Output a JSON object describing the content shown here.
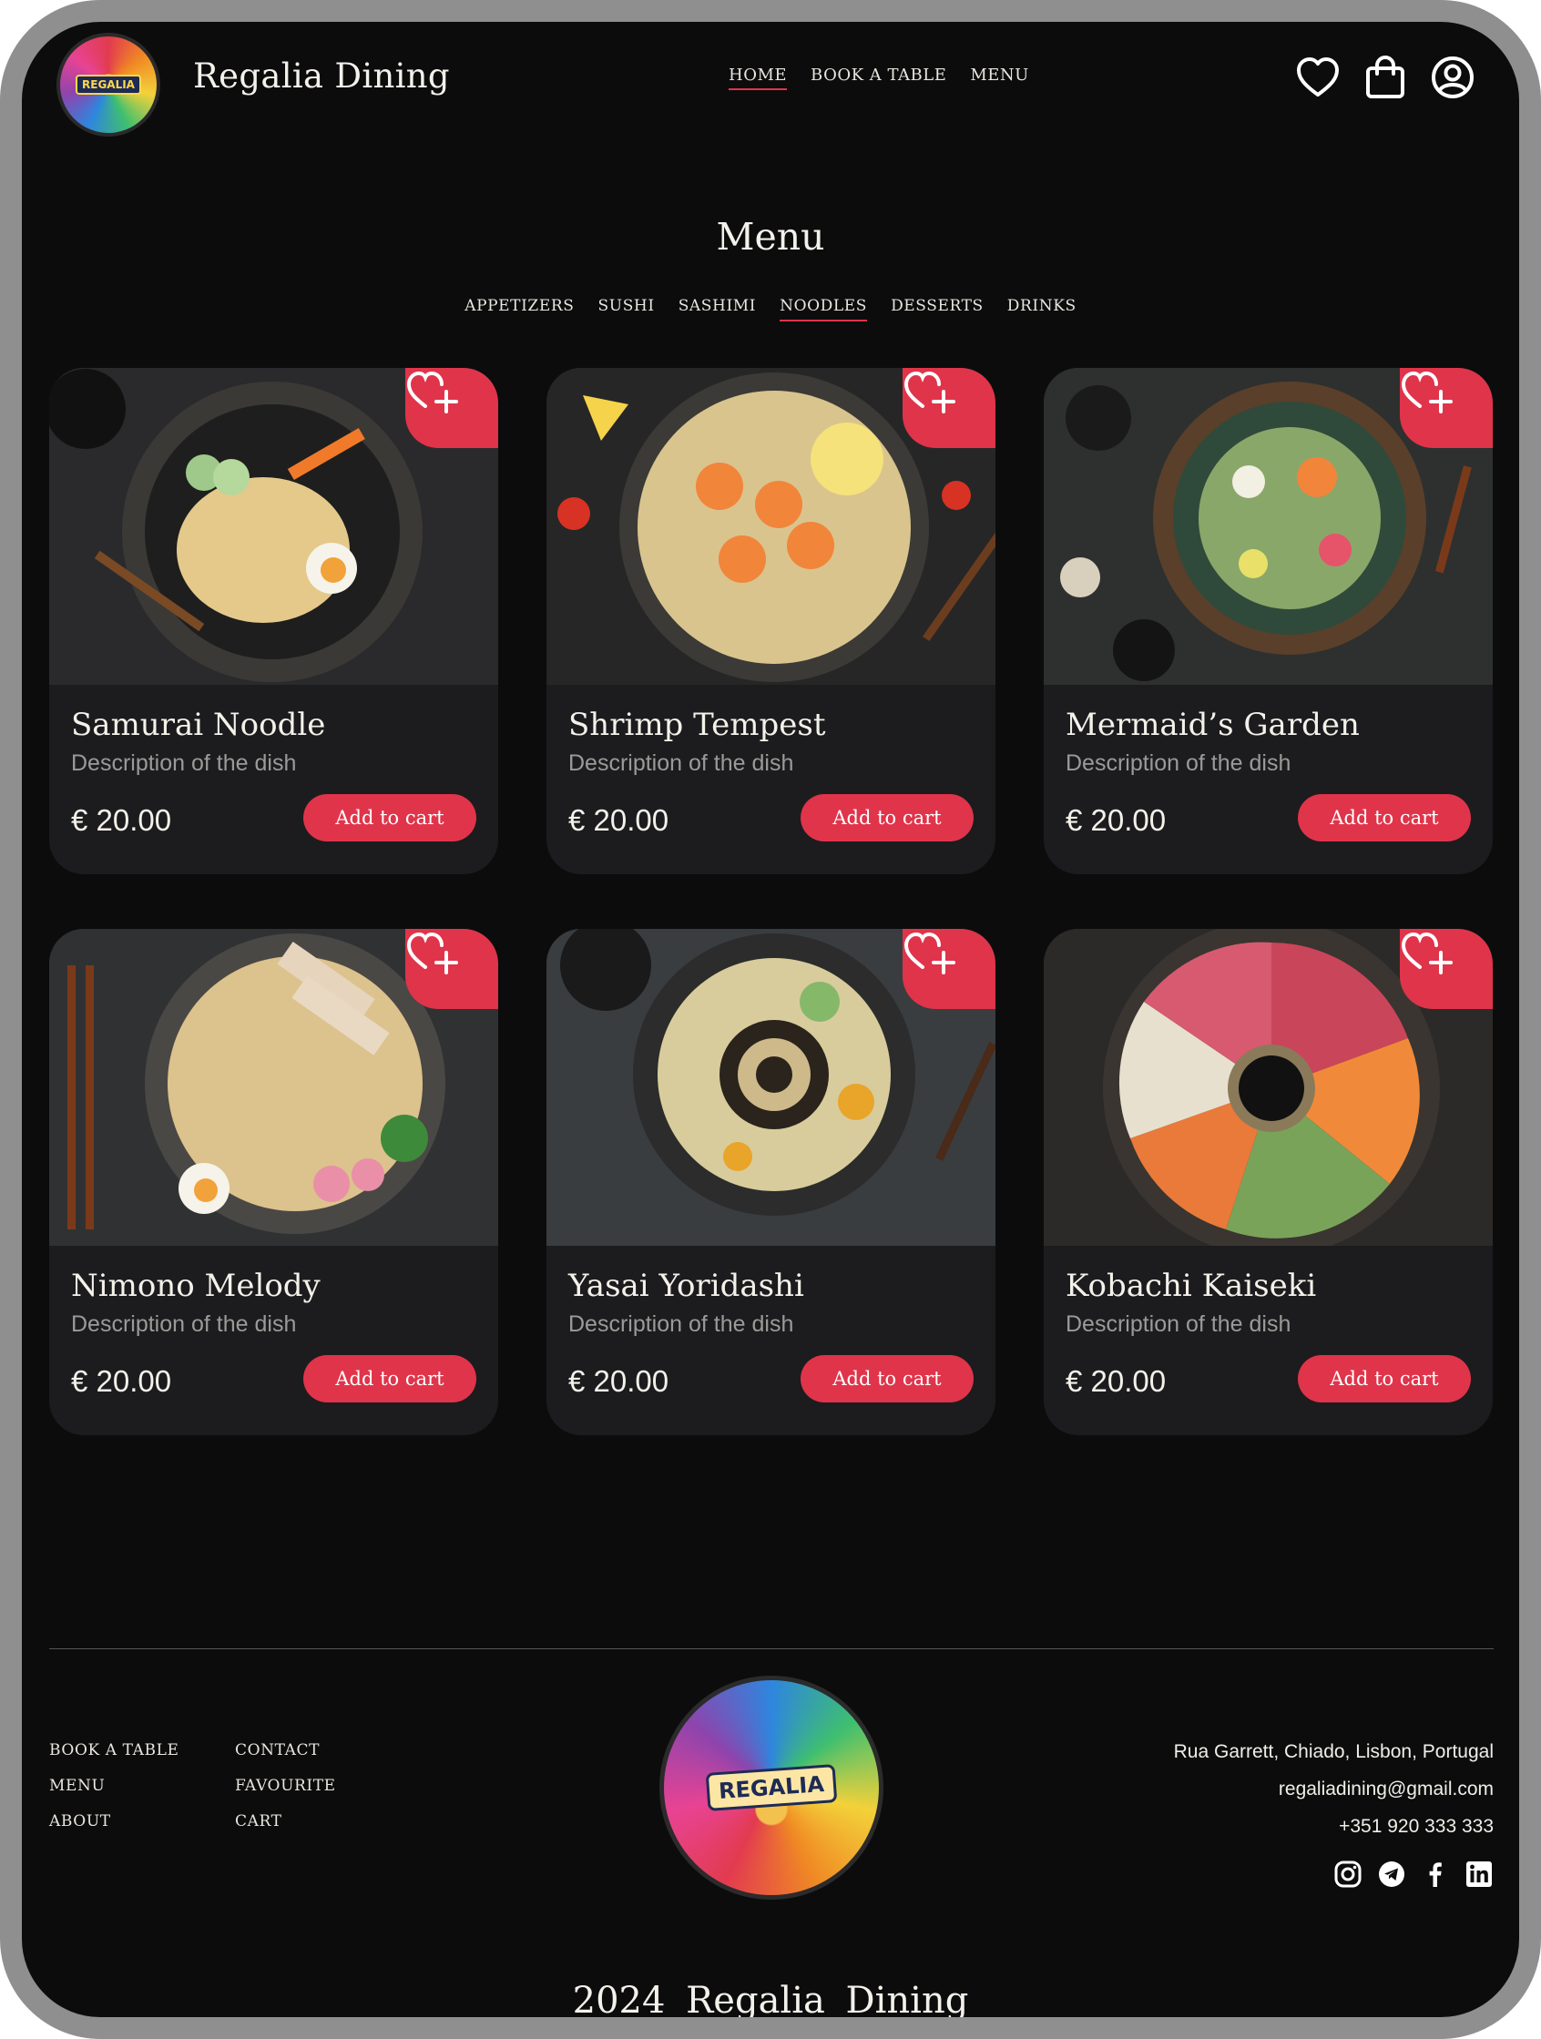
{
  "header": {
    "brand": "Regalia Dining",
    "logo_text": "REGALIA",
    "nav": [
      "HOME",
      "BOOK A TABLE",
      "MENU"
    ],
    "icons": [
      "heart-icon",
      "shopping-bag-icon",
      "user-icon"
    ]
  },
  "menu": {
    "title": "Menu",
    "categories": [
      "APPETIZERS",
      "SUSHI",
      "SASHIMI",
      "NOODLES",
      "DESSERTS",
      "DRINKS"
    ],
    "active_category": "NOODLES"
  },
  "dishes": [
    {
      "name": "Samurai Noodle",
      "description": "Description of the dish",
      "price": "€ 20.00",
      "button": "Add to cart"
    },
    {
      "name": "Shrimp Tempest",
      "description": "Description of the dish",
      "price": "€ 20.00",
      "button": "Add to cart"
    },
    {
      "name": "Mermaid’s Garden",
      "description": "Description of the dish",
      "price": "€ 20.00",
      "button": "Add to cart"
    },
    {
      "name": "Nimono Melody",
      "description": "Description of the dish",
      "price": "€ 20.00",
      "button": "Add to cart"
    },
    {
      "name": "Yasai Yoridashi",
      "description": "Description of the dish",
      "price": "€ 20.00",
      "button": "Add to cart"
    },
    {
      "name": "Kobachi Kaiseki",
      "description": "Description of the dish",
      "price": "€ 20.00",
      "button": "Add to cart"
    }
  ],
  "footer": {
    "links_col1": [
      "BOOK A TABLE",
      "MENU",
      "ABOUT"
    ],
    "links_col2": [
      "CONTACT",
      "FAVOURITE",
      "CART"
    ],
    "logo_text": "REGALIA",
    "address": "Rua Garrett, Chiado, Lisbon, Portugal",
    "email": "regaliadining@gmail.com",
    "phone": "+351 920 333 333",
    "social_icons": [
      "instagram-icon",
      "telegram-icon",
      "facebook-icon",
      "linkedin-icon"
    ],
    "copyright": "2024 Regalia Dining"
  },
  "colors": {
    "background": "#0c0c0d",
    "card": "#1c1c1e",
    "accent": "#e0344a",
    "frame": "#8f8f8f"
  }
}
